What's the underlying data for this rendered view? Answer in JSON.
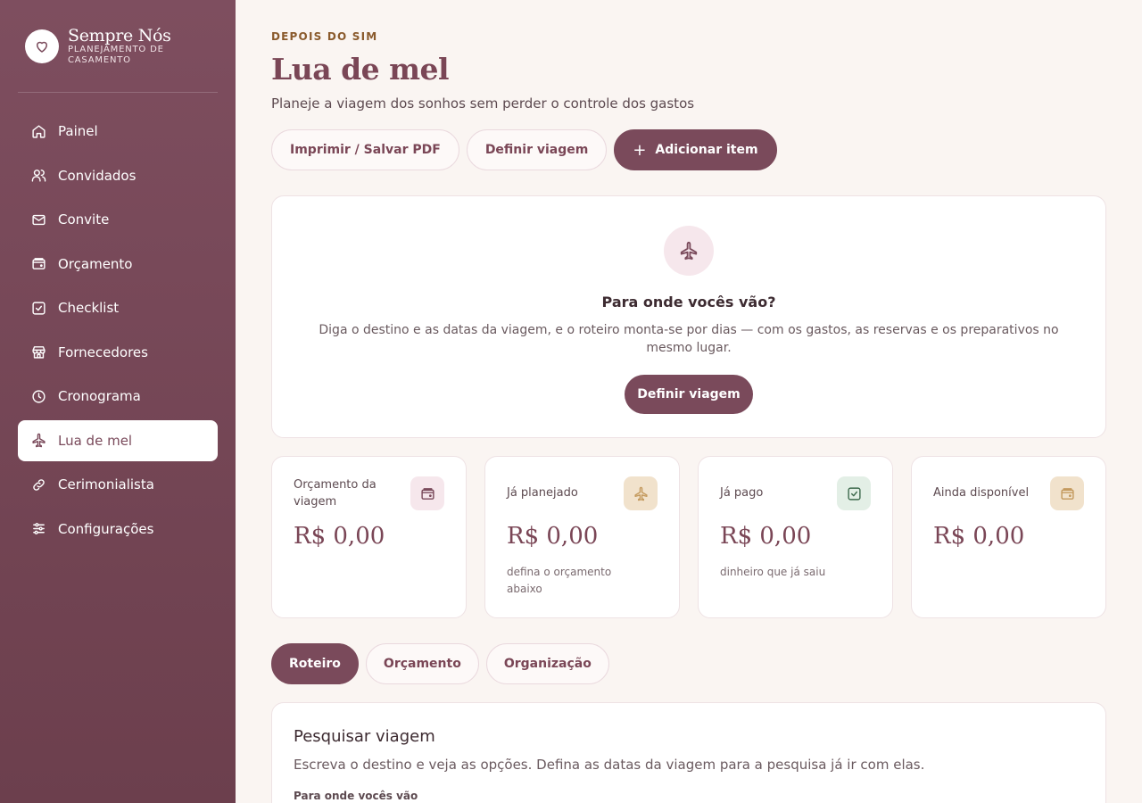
{
  "sidebar": {
    "brand": {
      "name": "Sempre Nós",
      "subtitle": "PLANEJAMENTO DE CASAMENTO",
      "logo_icon": "heart-icon"
    },
    "items": [
      {
        "label": "Painel",
        "icon": "home-icon",
        "active": false
      },
      {
        "label": "Convidados",
        "icon": "users-icon",
        "active": false
      },
      {
        "label": "Convite",
        "icon": "mail-icon",
        "active": false
      },
      {
        "label": "Orçamento",
        "icon": "wallet-icon",
        "active": false
      },
      {
        "label": "Checklist",
        "icon": "check-square-icon",
        "active": false
      },
      {
        "label": "Fornecedores",
        "icon": "store-icon",
        "active": false
      },
      {
        "label": "Cronograma",
        "icon": "clock-icon",
        "active": false
      },
      {
        "label": "Lua de mel",
        "icon": "plane-icon",
        "active": true
      },
      {
        "label": "Cerimonialista",
        "icon": "link-icon",
        "active": false
      },
      {
        "label": "Configurações",
        "icon": "sliders-icon",
        "active": false
      }
    ]
  },
  "header": {
    "eyebrow": "DEPOIS DO SIM",
    "title": "Lua de mel",
    "subtitle": "Planeje a viagem dos sonhos sem perder o controle dos gastos"
  },
  "actions": {
    "print": "Imprimir / Salvar PDF",
    "define": "Definir viagem",
    "add": "Adicionar item"
  },
  "hero": {
    "icon": "plane-icon",
    "title": "Para onde vocês vão?",
    "text": "Diga o destino e as datas da viagem, e o roteiro monta-se por dias — com os gastos, as reservas e os preparativos no mesmo lugar.",
    "button": "Definir viagem"
  },
  "stats": [
    {
      "label": "Orçamento da viagem",
      "value": "R$ 0,00",
      "note": "",
      "icon": "wallet-icon",
      "icon_bg": "#f6e7ec",
      "icon_color": "#7a4a5b"
    },
    {
      "label": "Já planejado",
      "value": "R$ 0,00",
      "note": "defina o orçamento abaixo",
      "icon": "plane-icon",
      "icon_bg": "#f1e2cc",
      "icon_color": "#c49a5e"
    },
    {
      "label": "Já pago",
      "value": "R$ 0,00",
      "note": "dinheiro que já saiu",
      "icon": "check-square-icon",
      "icon_bg": "#e3efe6",
      "icon_color": "#3f6b4e"
    },
    {
      "label": "Ainda disponível",
      "value": "R$ 0,00",
      "note": "",
      "icon": "wallet-icon",
      "icon_bg": "#f1e2cc",
      "icon_color": "#c49a5e"
    }
  ],
  "tabs": [
    {
      "label": "Roteiro",
      "active": true
    },
    {
      "label": "Orçamento",
      "active": false
    },
    {
      "label": "Organização",
      "active": false
    }
  ],
  "search": {
    "title": "Pesquisar viagem",
    "description": "Escreva o destino e veja as opções. Defina as datas da viagem para a pesquisa já ir com elas.",
    "field_label": "Para onde vocês vão"
  },
  "colors": {
    "sidebar": "#7a4a5b",
    "accent": "#7a4a5b",
    "background": "#faf5f2",
    "eyebrow": "#8a5a2c"
  }
}
